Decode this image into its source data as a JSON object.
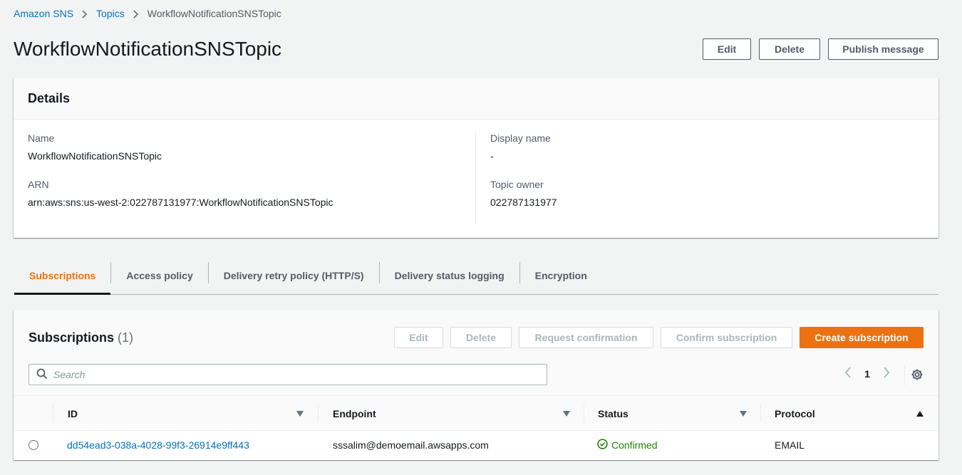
{
  "breadcrumb": {
    "root": "Amazon SNS",
    "topics": "Topics",
    "current": "WorkflowNotificationSNSTopic"
  },
  "page": {
    "title": "WorkflowNotificationSNSTopic",
    "edit_label": "Edit",
    "delete_label": "Delete",
    "publish_label": "Publish message"
  },
  "details": {
    "title": "Details",
    "name_label": "Name",
    "name_value": "WorkflowNotificationSNSTopic",
    "arn_label": "ARN",
    "arn_value": "arn:aws:sns:us-west-2:022787131977:WorkflowNotificationSNSTopic",
    "display_name_label": "Display name",
    "display_name_value": "-",
    "owner_label": "Topic owner",
    "owner_value": "022787131977"
  },
  "tabs": [
    {
      "label": "Subscriptions",
      "active": true
    },
    {
      "label": "Access policy",
      "active": false
    },
    {
      "label": "Delivery retry policy (HTTP/S)",
      "active": false
    },
    {
      "label": "Delivery status logging",
      "active": false
    },
    {
      "label": "Encryption",
      "active": false
    }
  ],
  "subscriptions": {
    "title": "Subscriptions",
    "count": "(1)",
    "edit_label": "Edit",
    "delete_label": "Delete",
    "request_label": "Request confirmation",
    "confirm_label": "Confirm subscription",
    "create_label": "Create subscription",
    "search_placeholder": "Search",
    "page_number": "1",
    "columns": {
      "id": "ID",
      "endpoint": "Endpoint",
      "status": "Status",
      "protocol": "Protocol"
    },
    "rows": [
      {
        "id": "dd54ead3-038a-4028-99f3-26914e9ff443",
        "endpoint": "sssalim@demoemail.awsapps.com",
        "status": "Confirmed",
        "protocol": "EMAIL"
      }
    ]
  },
  "colors": {
    "accent": "#ec7211",
    "link": "#0073bb",
    "success": "#1d8102"
  }
}
